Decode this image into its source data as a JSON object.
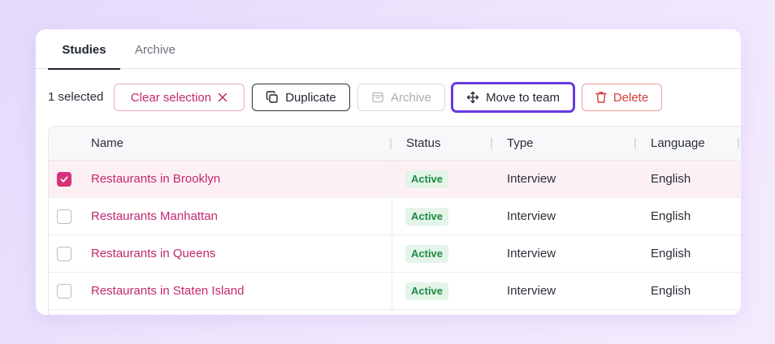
{
  "tabs": [
    {
      "label": "Studies",
      "active": true
    },
    {
      "label": "Archive",
      "active": false
    }
  ],
  "toolbar": {
    "selected_count": "1 selected",
    "clear_label": "Clear selection",
    "duplicate_label": "Duplicate",
    "archive_label": "Archive",
    "move_label": "Move to team",
    "delete_label": "Delete"
  },
  "table": {
    "columns": [
      "Name",
      "Status",
      "Type",
      "Language"
    ],
    "rows": [
      {
        "name": "Restaurants in Brooklyn",
        "status": "Active",
        "type": "Interview",
        "language": "English",
        "selected": true
      },
      {
        "name": "Restaurants Manhattan",
        "status": "Active",
        "type": "Interview",
        "language": "English",
        "selected": false
      },
      {
        "name": "Restaurants in Queens",
        "status": "Active",
        "type": "Interview",
        "language": "English",
        "selected": false
      },
      {
        "name": "Restaurants in Staten Island",
        "status": "Active",
        "type": "Interview",
        "language": "English",
        "selected": false
      }
    ]
  },
  "colors": {
    "accent": "#c2286d",
    "focus_ring": "#6a3be0",
    "danger": "#d93a3a",
    "status_active": "#1f8a44"
  },
  "icons": {
    "clear": "close-icon",
    "duplicate": "copy-icon",
    "archive": "archive-box-icon",
    "move": "move-arrows-icon",
    "delete": "trash-icon",
    "checkbox": "checkmark-icon"
  }
}
